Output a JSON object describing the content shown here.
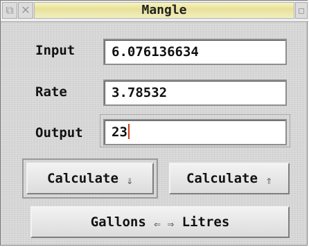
{
  "window": {
    "title": "Mangle",
    "back_icon": "back-icon",
    "close_icon": "close-icon",
    "toggle_icon": "toggle-size-icon"
  },
  "form": {
    "input_label": "Input",
    "input_value": "6.076136634",
    "rate_label": "Rate",
    "rate_value": "3.78532",
    "output_label": "Output",
    "output_value": "23"
  },
  "buttons": {
    "calc_down_label": "Calculate",
    "calc_down_arrow": "⇓",
    "calc_up_label": "Calculate",
    "calc_up_arrow": "⇑",
    "convert_from": "Gallons",
    "convert_arrows": "⇐ ⇒",
    "convert_to": "Litres"
  },
  "colors": {
    "title_bar_accent": "#e8e19a",
    "caret": "#d03a1a"
  }
}
